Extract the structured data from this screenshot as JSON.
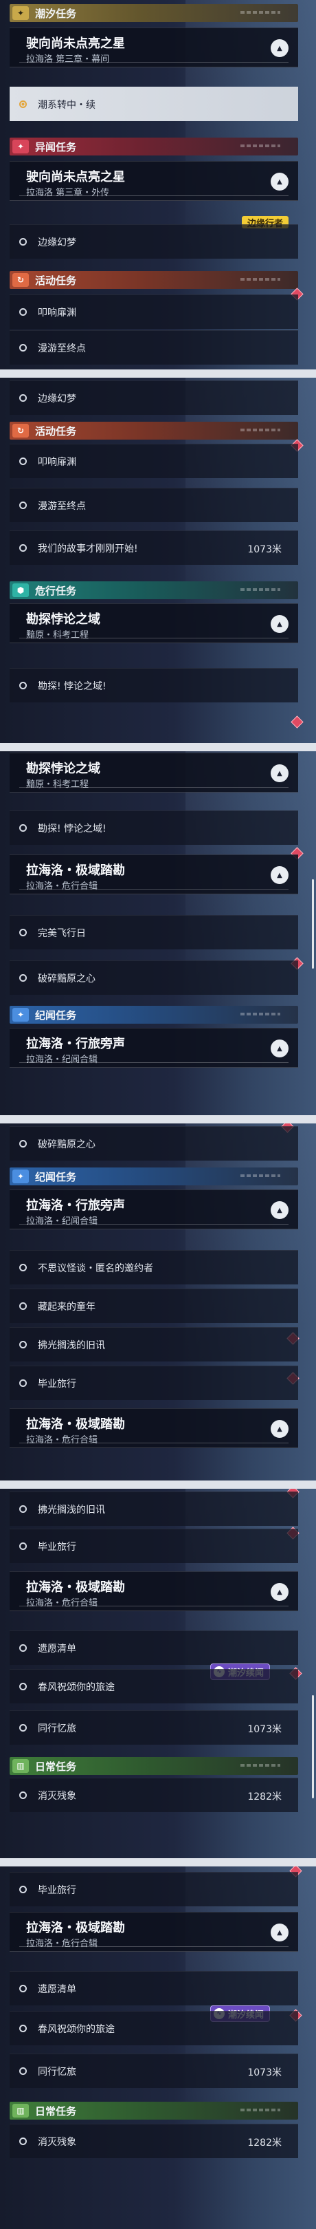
{
  "colors": {
    "accent_gold": "#c9a94a",
    "tag_yellow": "#f3cd36",
    "tag_purple": "#6c4cc2",
    "marker_red": "#e04a62"
  },
  "categories": {
    "chaoxi": "潮汐任务",
    "yiwen": "异闻任务",
    "huodong": "活动任务",
    "weixing": "危行任务",
    "jiwen": "纪闻任务",
    "richang": "日常任务"
  },
  "quests": {
    "q1": {
      "title": "驶向尚未点亮之星",
      "sub": "拉海洛 第三章・幕间"
    },
    "q2": {
      "title": "驶向尚未点亮之星",
      "sub": "拉海洛 第三章・外传"
    },
    "q3": {
      "title": "勘探悖论之域",
      "sub": "黯原・科考工程"
    },
    "q4": {
      "title": "拉海洛・极域踏勘",
      "sub": "拉海洛・危行合辑"
    },
    "q5": {
      "title": "拉海洛・行旅旁声",
      "sub": "拉海洛・纪闻合辑"
    }
  },
  "steps": {
    "chaoxing": "潮系转中・续",
    "bianyuan": "边缘幻梦",
    "jixiang": "叩响扉渊",
    "manyou": "漫游至终点",
    "gushi": "我们的故事才刚刚开始!",
    "kantan": "勘探! 悖论之域!",
    "wanmei": "完美飞行日",
    "posui": "破碎黯原之心",
    "busi": "不思议怪谈・匿名的邀约者",
    "cangqi": "藏起来的童年",
    "fuguang": "拂光搁浅的旧讯",
    "biye": "毕业旅行",
    "yizhi": "遗愿清单",
    "chunfeng": "春风祝颂你的旅途",
    "tongxing": "同行忆旅",
    "xiaomie": "消灭残象"
  },
  "distances": {
    "d1": "1073米",
    "d2": "1282米"
  },
  "tags": {
    "bianyuanxing": "边缘行者",
    "chaoxi_xuwen": "潮汐续闻"
  },
  "icons": {
    "chaoxi": "plus-star-icon",
    "yiwen": "plus-star-icon",
    "huodong": "swirl-icon",
    "weixing": "hex-icon",
    "jiwen": "plus-star-icon",
    "richang": "book-icon"
  }
}
